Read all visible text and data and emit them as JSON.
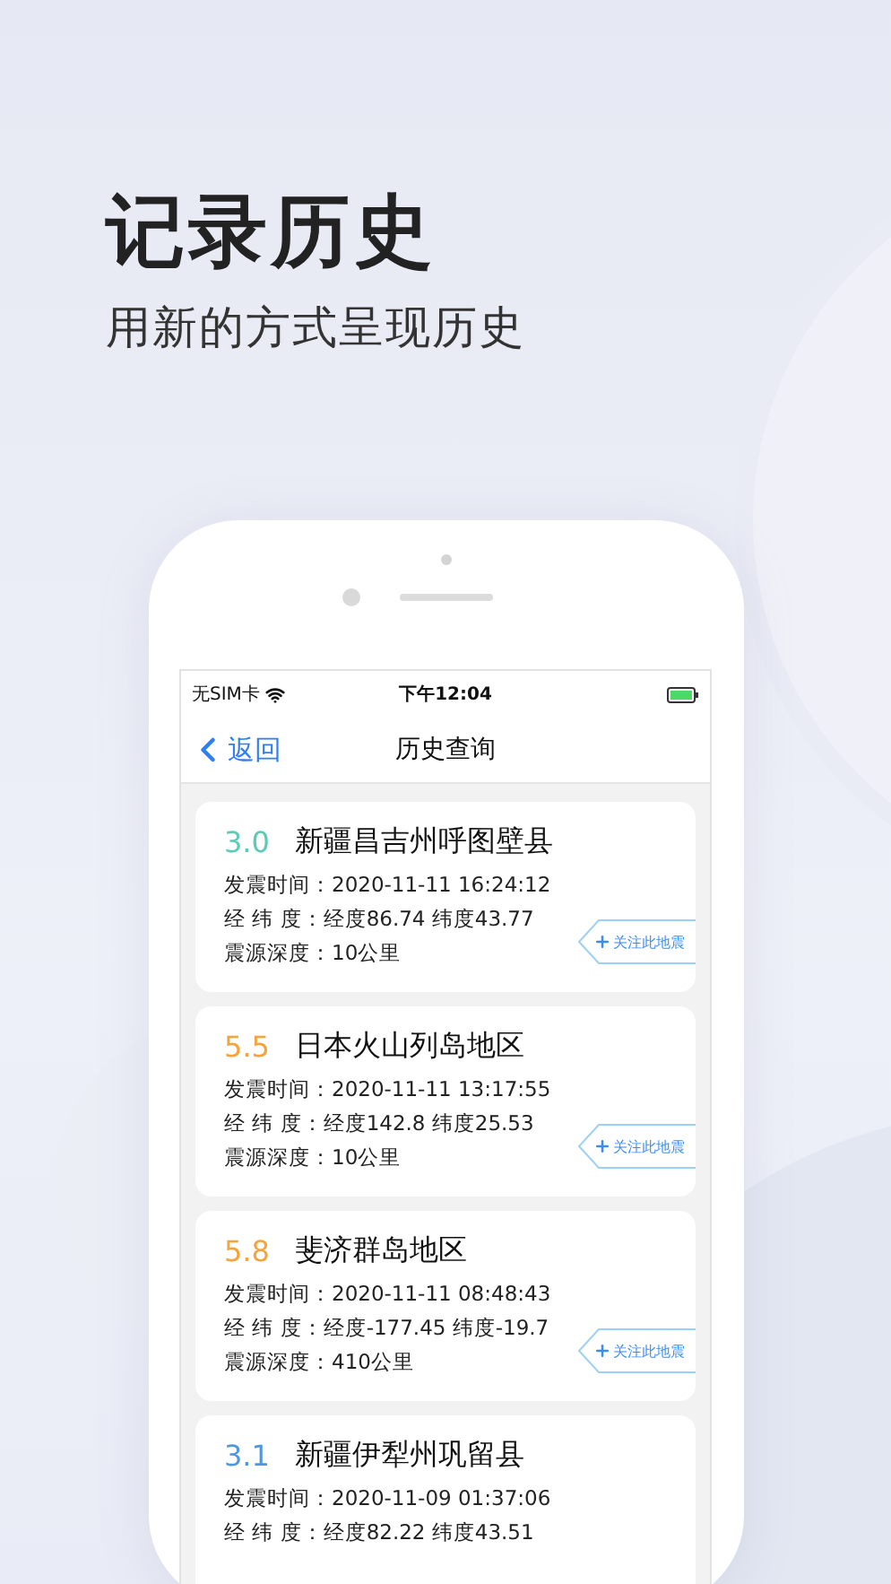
{
  "headline": "记录历史",
  "subheadline": "用新的方式呈现历史",
  "status_bar": {
    "carrier": "无SIM卡",
    "time": "下午12:04"
  },
  "nav": {
    "back": "返回",
    "title": "历史查询"
  },
  "earthquakes": [
    {
      "magnitude": "3.0",
      "color": "#5ccbb6",
      "place": "新疆昌吉州呼图壁县",
      "time_label": "发震时间：",
      "time": "2020-11-11 16:24:12",
      "coord_label": "经 纬 度：",
      "coords": "经度86.74 纬度43.77",
      "depth_label": "震源深度：",
      "depth": "10公里",
      "follow": "关注此地震"
    },
    {
      "magnitude": "5.5",
      "color": "#f5a33a",
      "place": "日本火山列岛地区",
      "time_label": "发震时间：",
      "time": "2020-11-11 13:17:55",
      "coord_label": "经 纬 度：",
      "coords": "经度142.8 纬度25.53",
      "depth_label": "震源深度：",
      "depth": "10公里",
      "follow": "关注此地震"
    },
    {
      "magnitude": "5.8",
      "color": "#f5a33a",
      "place": "斐济群岛地区",
      "time_label": "发震时间：",
      "time": "2020-11-11 08:48:43",
      "coord_label": "经 纬 度：",
      "coords": "经度-177.45 纬度-19.7",
      "depth_label": "震源深度：",
      "depth": "410公里",
      "follow": "关注此地震"
    },
    {
      "magnitude": "3.1",
      "color": "#4f97dc",
      "place": "新疆伊犁州巩留县",
      "time_label": "发震时间：",
      "time": "2020-11-09 01:37:06",
      "coord_label": "经 纬 度：",
      "coords": "经度82.22 纬度43.51"
    }
  ]
}
